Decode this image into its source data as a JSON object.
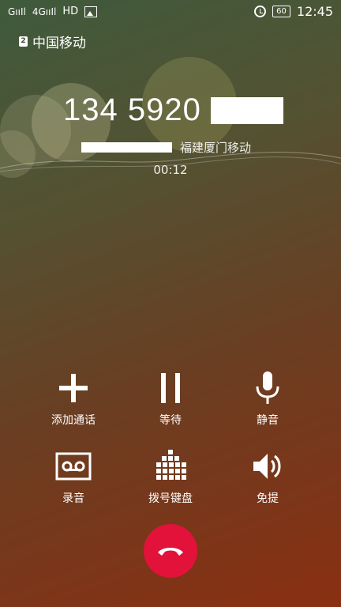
{
  "status_bar": {
    "signal_1": "GııIl",
    "signal_2": "4GııIl",
    "hd": "HD",
    "battery": "60",
    "time": "12:45",
    "icons": [
      "signal-icon",
      "signal-icon",
      "gallery-icon",
      "alarm-icon",
      "battery-icon"
    ]
  },
  "call": {
    "sim_badge": "2",
    "carrier": "中国移动",
    "number": "134 5920",
    "location": "福建厦门移动",
    "duration": "00:12"
  },
  "actions": [
    {
      "label": "添加通话",
      "icon": "add-call-icon"
    },
    {
      "label": "等待",
      "icon": "pause-icon"
    },
    {
      "label": "静音",
      "icon": "microphone-icon"
    },
    {
      "label": "录音",
      "icon": "voicemail-record-icon"
    },
    {
      "label": "拨号键盘",
      "icon": "dialpad-icon"
    },
    {
      "label": "免提",
      "icon": "speaker-icon"
    }
  ],
  "end_call": {
    "icon": "hang-up-icon",
    "color": "#e3123a"
  }
}
